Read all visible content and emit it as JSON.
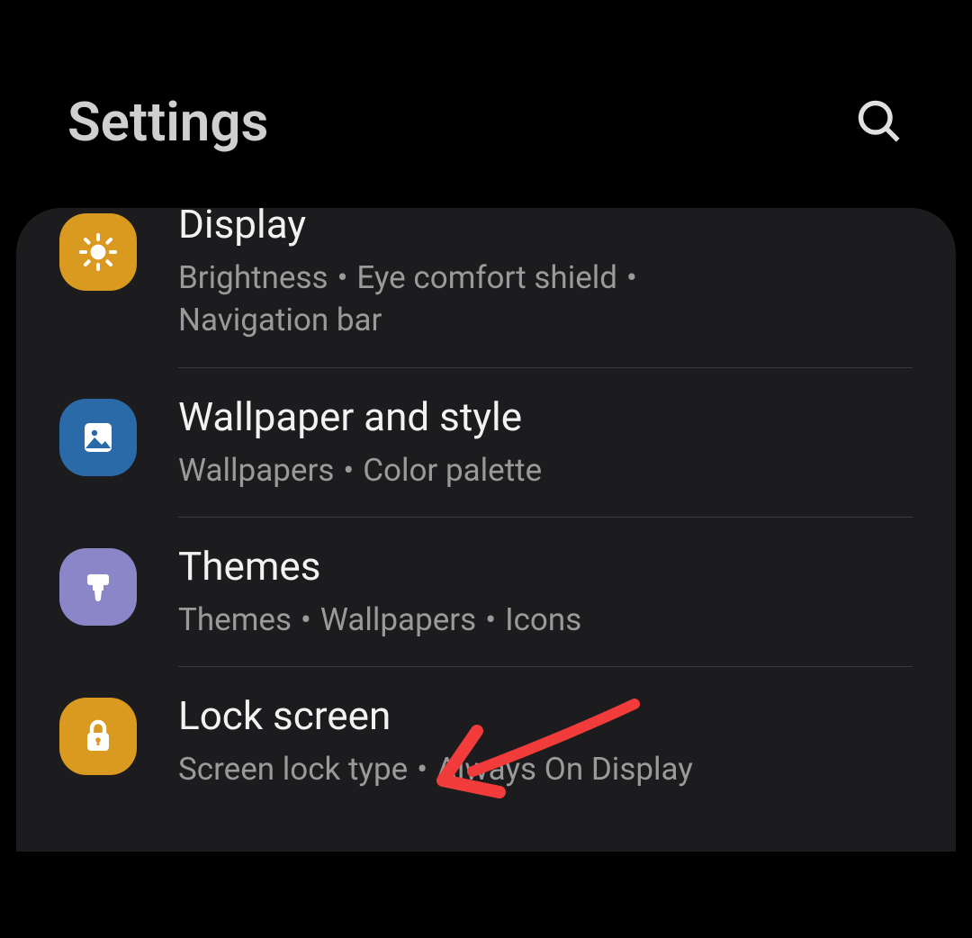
{
  "header": {
    "title": "Settings",
    "search_label": "Search"
  },
  "items": [
    {
      "id": "display",
      "icon": "brightness",
      "icon_color": "#d99a1f",
      "title": "Display",
      "subs": [
        "Brightness",
        "Eye comfort shield",
        "Navigation bar"
      ]
    },
    {
      "id": "wallpaper",
      "icon": "image",
      "icon_color": "#2b6aa8",
      "title": "Wallpaper and style",
      "subs": [
        "Wallpapers",
        "Color palette"
      ]
    },
    {
      "id": "themes",
      "icon": "brush",
      "icon_color": "#8a86c8",
      "title": "Themes",
      "subs": [
        "Themes",
        "Wallpapers",
        "Icons"
      ]
    },
    {
      "id": "lockscreen",
      "icon": "lock",
      "icon_color": "#d99a1f",
      "title": "Lock screen",
      "subs": [
        "Screen lock type",
        "Always On Display"
      ]
    }
  ],
  "annotation": {
    "color": "#f23b3b",
    "points_to": "lockscreen"
  }
}
